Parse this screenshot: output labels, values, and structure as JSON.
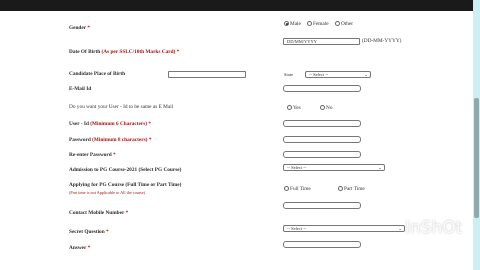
{
  "form": {
    "gender": {
      "label": "Gender",
      "req": "*",
      "options": [
        "Male",
        "Female",
        "Other"
      ],
      "selected": "Male"
    },
    "dob": {
      "label": "Date Of Birth ",
      "label_note": "(As per SSLC/10th Marks Card)",
      "req": "*",
      "value": "DD/MM/YYYY",
      "hint": "(DD-MM-YYYY)"
    },
    "birthplace": {
      "label": "Candidate Place of Birth",
      "state_label": "State",
      "state_value": "-- Select --"
    },
    "email": {
      "label": "E-Mail Id"
    },
    "same_as_email": {
      "label": "Do you want your User - Id to be same as E Mail",
      "options": [
        "Yes",
        "No"
      ]
    },
    "userid": {
      "label": "User - Id ",
      "label_note": "(Minimum 6 Characters)",
      "req": "*"
    },
    "password": {
      "label": "Password ",
      "label_note": "(Minimum 8 characters)",
      "req": "*"
    },
    "reenter": {
      "label": "Re-enter Password",
      "req": "*"
    },
    "admission": {
      "label": "Admission to PG Course-2021 (Select PG Course)",
      "value": "-- Select --"
    },
    "applying": {
      "label": "Applying for PG Course (Full Time or Part Time)",
      "note": "(Part time is not Applicable to All the course)",
      "options": [
        "Full Time",
        "Part Time"
      ]
    },
    "mobile": {
      "label": "Contact Mobile Number",
      "req": "*"
    },
    "secret": {
      "label": "Secret Question",
      "req": "*",
      "value": "-- Select --"
    },
    "answer": {
      "label": "Answer",
      "req": "*"
    }
  },
  "watermark": {
    "text": "InShOt"
  },
  "colors": {
    "background": "#9fd9df",
    "label_red": "#9b1111",
    "required": "#cc0000"
  }
}
